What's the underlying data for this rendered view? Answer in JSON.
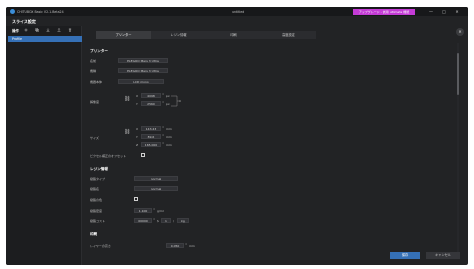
{
  "window": {
    "app_title": "CHITUBOX Basic V2.1.Beta24",
    "doc_title": "untitled",
    "trial_badge": "アップグレード - 試用 ultimate 機能",
    "min_glyph": "—",
    "max_glyph": "□",
    "close_glyph": "✕"
  },
  "header": {
    "title": "スライス設定",
    "close_glyph": "✕"
  },
  "left_panel": {
    "toolbar_label": "操作",
    "tools": [
      "add-icon",
      "copy-icon",
      "import-icon",
      "export-icon",
      "delete-icon"
    ],
    "profiles": [
      {
        "label": "Profile"
      }
    ]
  },
  "tabs": [
    {
      "label": "プリンター",
      "active": true
    },
    {
      "label": "レジン情報",
      "active": false
    },
    {
      "label": "印刷",
      "active": false
    },
    {
      "label": "高度設定",
      "active": false
    }
  ],
  "printer": {
    "section_title": "プリンター",
    "name_label": "名前",
    "name_value": "ELEGOO Mars 3 Ultra",
    "model_label": "機種",
    "model_value": "ELEGOO Mars 3 Ultra",
    "machine_type_label": "機器本体",
    "machine_type_value": "LCD mono",
    "resolution_label": "解像度",
    "resolution_x": "4098",
    "resolution_y": "2560",
    "resolution_unit": "px",
    "size_label": "サイズ",
    "size_x": "143.43",
    "size_y": "89.6",
    "size_z": "165.000",
    "size_unit": "mm",
    "axis_x": "X",
    "axis_y": "Y",
    "axis_z": "Z",
    "offset_label": "ピクセル補正のオフセット",
    "offset_checked": false
  },
  "resin": {
    "section_title": "レジン情報",
    "type_label": "樹脂タイプ",
    "type_value": "normal",
    "resin_name_label": "樹脂名",
    "resin_name_value": "normal",
    "custom_label": "樹脂の色",
    "custom_checked": false,
    "density_label": "樹脂密度",
    "density_value": "1.100",
    "density_unit": "g/ml",
    "cost_label": "樹脂コスト",
    "cost_value": "00000",
    "cost_unit": "$",
    "cost_per": "1",
    "cost_per_unit": "kg"
  },
  "print": {
    "section_title": "印刷",
    "layer_height_label": "レイヤーの高さ",
    "layer_height_value": "0.050",
    "layer_height_unit": "mm"
  },
  "footer": {
    "ok": "保存",
    "cancel": "キャンセル"
  },
  "colors": {
    "accent": "#3570b6",
    "trial": "#c43bd6",
    "panel": "#222325"
  }
}
